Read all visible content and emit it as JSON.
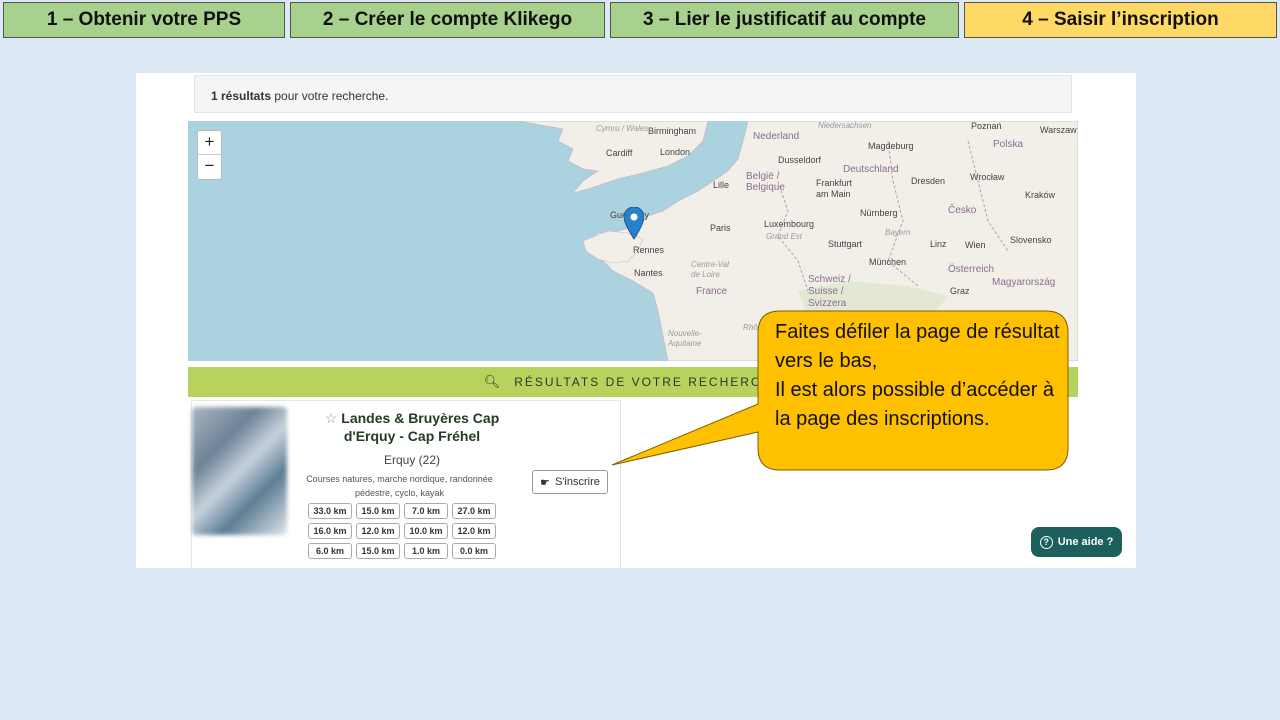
{
  "steps": [
    {
      "label": "1 – Obtenir votre PPS",
      "state": "done"
    },
    {
      "label": "2 – Créer le compte Klikego",
      "state": "done"
    },
    {
      "label": "3 – Lier le justificatif au compte",
      "state": "done"
    },
    {
      "label": "4 – Saisir l’inscription",
      "state": "current"
    }
  ],
  "results": {
    "count": "1 résultats",
    "suffix": " pour votre recherche."
  },
  "map": {
    "zoom_in": "+",
    "zoom_out": "−",
    "labels": {
      "nederland": "Nederland",
      "niedersachsen": "Niedersachsen",
      "poznan": "Poznań",
      "warszawa": "Warszaw",
      "cymru": "Cymru / Wales",
      "birmingham": "Birmingham",
      "polska": "Polska",
      "magdeburg": "Magdeburg",
      "cardiff": "Cardiff",
      "london": "London",
      "dusseldorf": "Dusseldorf",
      "deutschland": "Deutschland",
      "wroclaw": "Wrocław",
      "belgie": "België / Belgique",
      "frankfurt": "Frankfurt am Main",
      "dresden": "Dresden",
      "lille": "Lille",
      "krakow": "Kraków",
      "luxembourg": "Luxembourg",
      "nurnberg": "Nürnberg",
      "cesko": "Česko",
      "guernsey": "Guernsey",
      "paris": "Paris",
      "grandest": "Grand Est",
      "bayern": "Bayern",
      "rennes": "Rennes",
      "stuttgart": "Stuttgart",
      "linz": "Linz",
      "wien": "Wien",
      "slovensko": "Slovensko",
      "centre": "Centre-Val de Loire",
      "munchen": "München",
      "nantes": "Nantes",
      "osterreich": "Österreich",
      "magyar": "Magyarország",
      "schweiz": "Schweiz / Suisse / Svizzera",
      "france": "France",
      "graz": "Graz",
      "nouvelle": "Nouvelle-Aquitaine",
      "rhone": "Rhône"
    }
  },
  "results_header": {
    "icon": "search-icon",
    "label": "RÉSULTATS DE VOTRE RECHERCHE"
  },
  "event": {
    "star": "☆",
    "title": "Landes & Bruyères Cap d'Erquy - Cap Fréhel",
    "location": "Erquy (22)",
    "types": "Courses natures, marche nordique, randonnée pédestre, cyclo, kayak",
    "distances": [
      "33.0 km",
      "15.0 km",
      "7.0 km",
      "27.0 km",
      "16.0 km",
      "12.0 km",
      "10.0 km",
      "12.0 km",
      "6.0 km",
      "15.0 km",
      "1.0 km",
      "0.0 km"
    ],
    "signup": "S'inscrire"
  },
  "help": {
    "label": "Une aide ?"
  },
  "callout": {
    "lines": [
      "Faites défiler la page de résultat vers le bas,",
      "Il est alors possible d’accéder à la page des inscriptions."
    ],
    "fill": "#ffc000"
  }
}
